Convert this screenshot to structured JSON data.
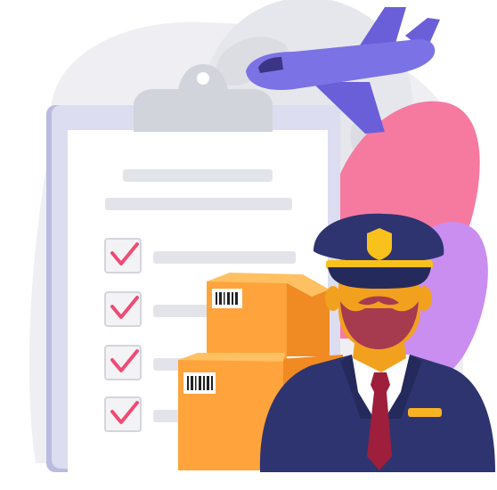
{
  "scene": {
    "subject": "customs-officer-with-parcels",
    "colors": {
      "background_blob": "#EFEFF3",
      "globe": "#E6E7EC",
      "globe_land": "#DCDDE3",
      "clipboard_board": "#DCDDF0",
      "clipboard_edge": "#B9BCE0",
      "clipboard_clip": "#D2D4DC",
      "paper": "#FFFFFF",
      "paper_lines": "#E3E4EA",
      "checkbox_fill": "#F3F3F6",
      "checkbox_border": "#D4D5DC",
      "check_mark": "#F04B75",
      "plane_body": "#7B72E6",
      "plane_wing": "#6A5FD8",
      "plane_window": "#3C3586",
      "leaf_pink": "#F67AA0",
      "leaf_violet": "#C98EF0",
      "box_front": "#FFA33C",
      "box_side": "#F08A22",
      "box_top": "#FFC062",
      "uniform": "#2E3470",
      "uniform_dark": "#252A5C",
      "shirt": "#FFFFFF",
      "tie": "#9E1F3C",
      "skin": "#F2A11E",
      "beard": "#A63A4F",
      "cap": "#2E3470",
      "cap_band": "#F9C11B",
      "badge": "#F9C11B",
      "name_tag": "#F9B222"
    },
    "checklist": {
      "items_checked": [
        true,
        true,
        true,
        true
      ]
    },
    "icons": [
      "airplane-icon",
      "globe-icon",
      "clipboard-icon",
      "checkbox-icon",
      "parcel-box-icon",
      "barcode-icon",
      "officer-icon",
      "cap-badge-icon"
    ]
  }
}
